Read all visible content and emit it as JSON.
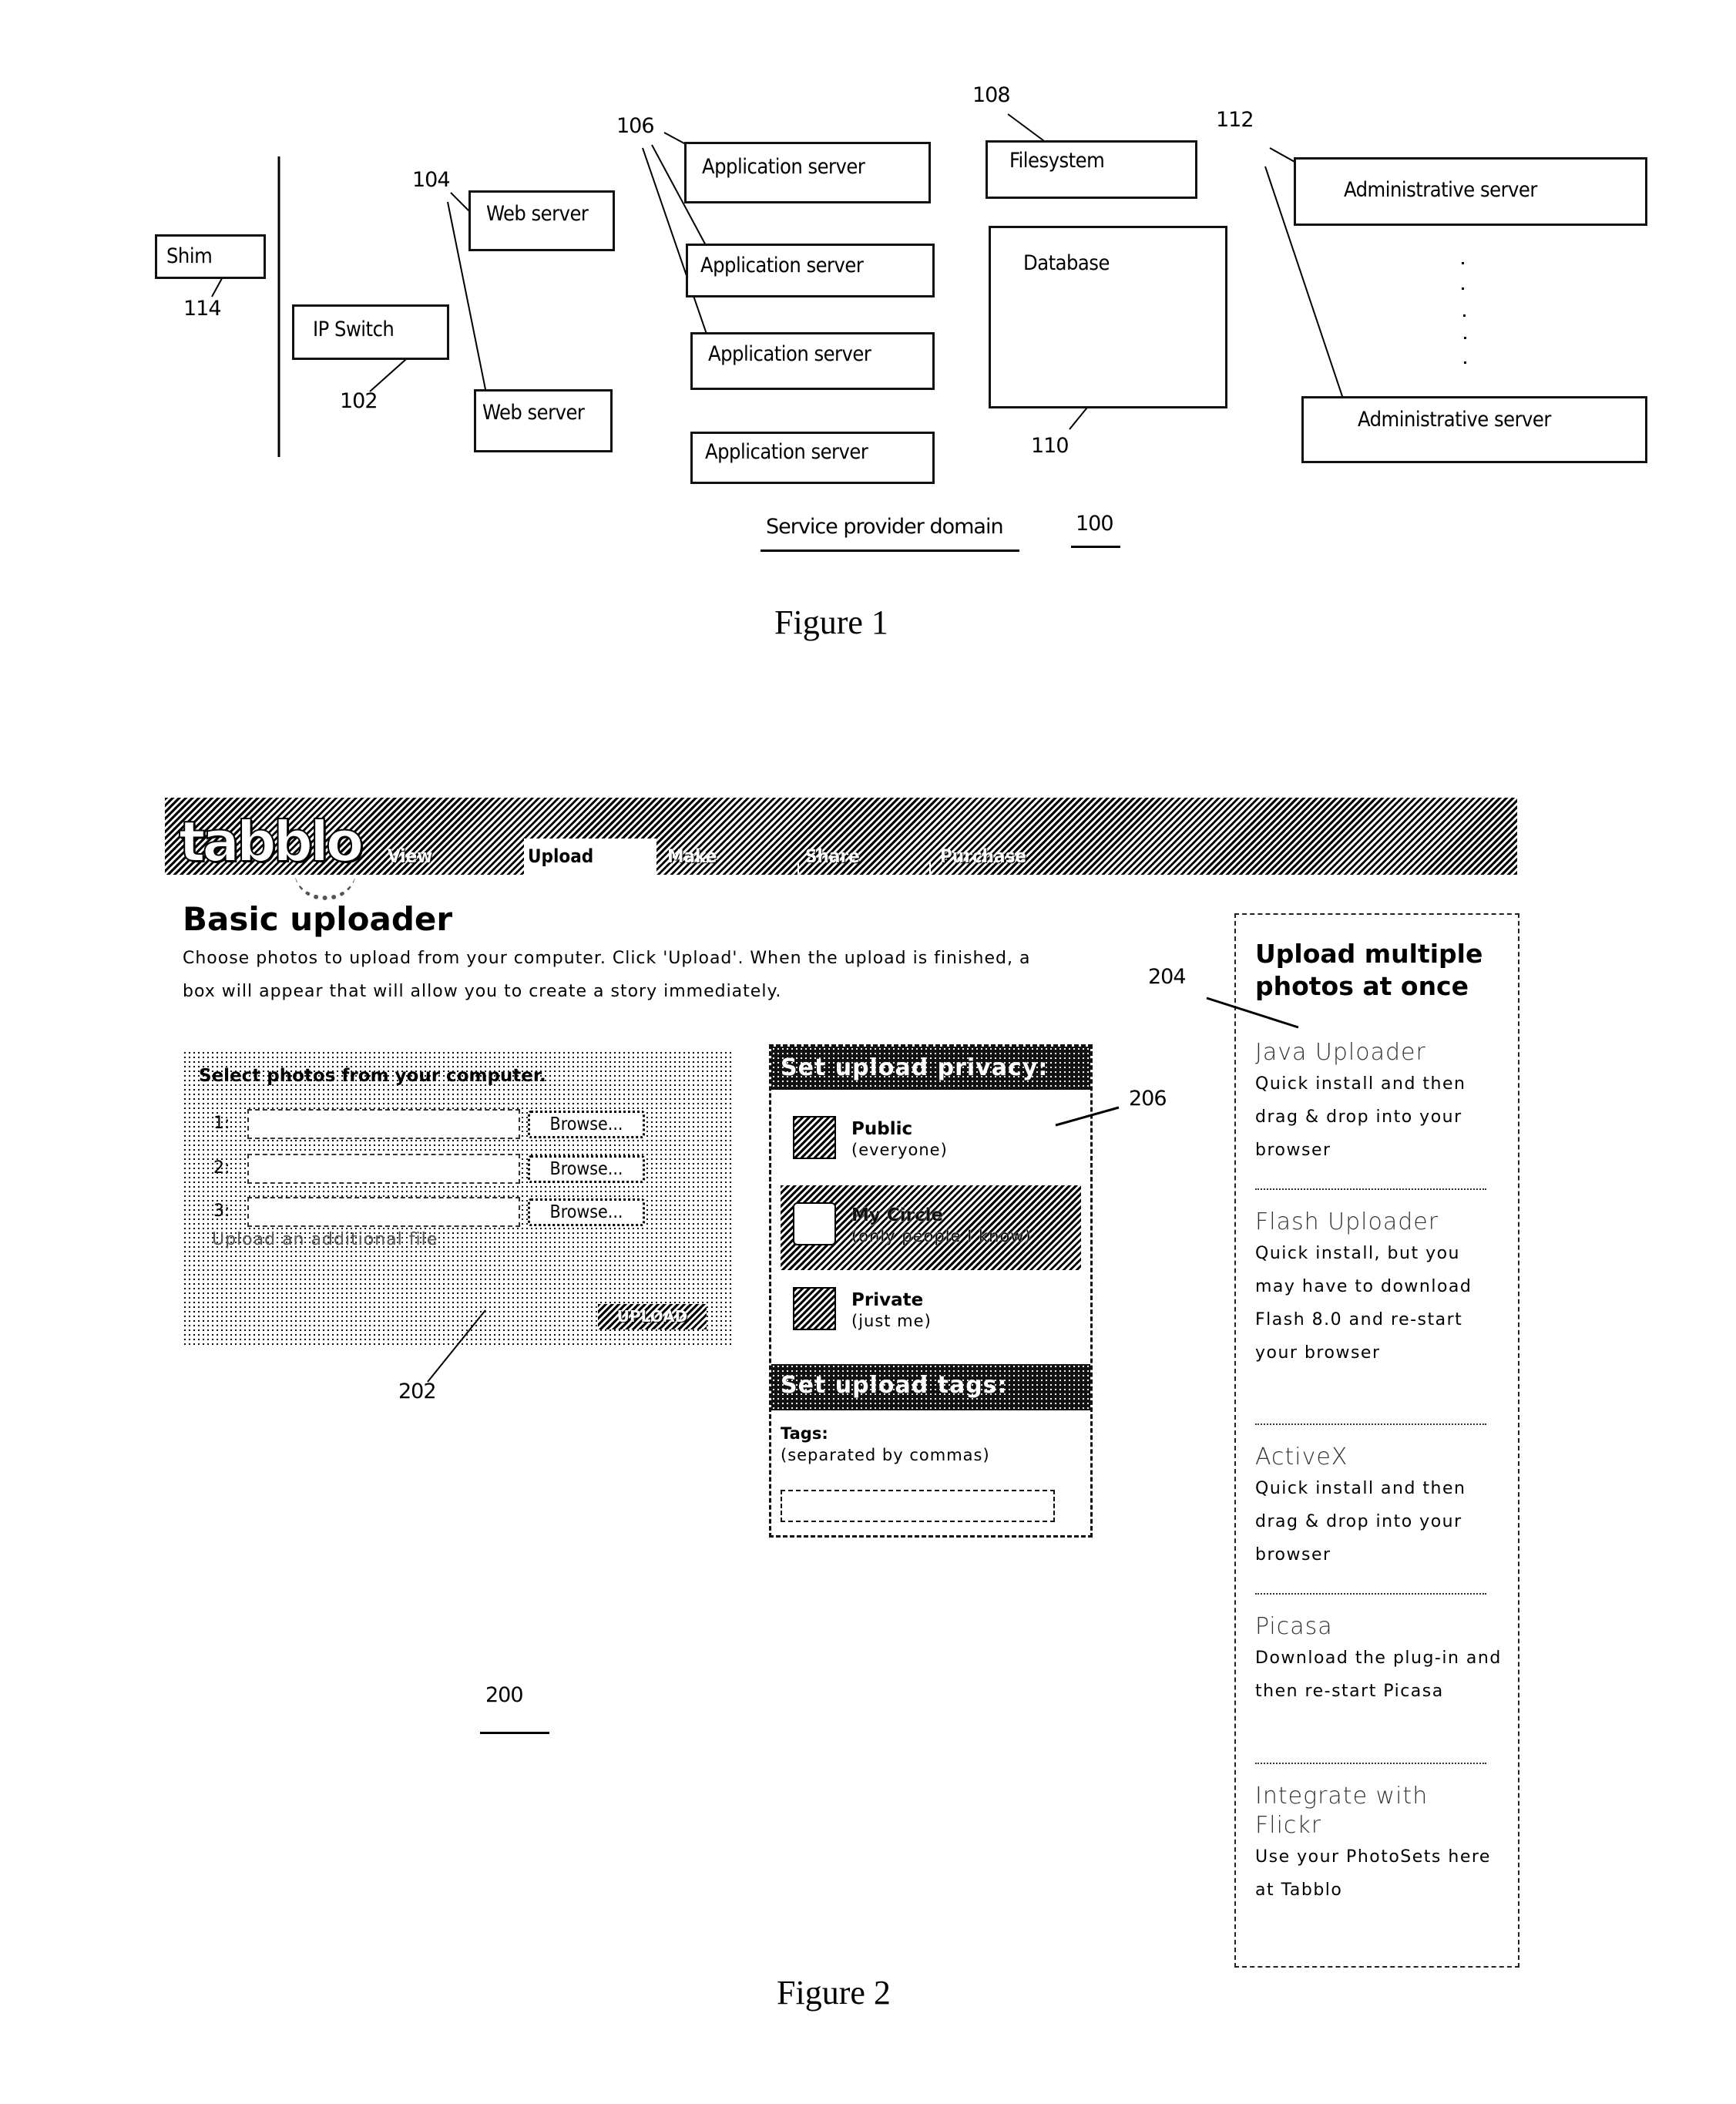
{
  "figure1": {
    "caption": "Figure 1",
    "domain_label": "Service provider domain",
    "domain_ref": "100",
    "components": {
      "shim": "Shim",
      "ip_switch": "IP Switch",
      "web_servers": [
        "Web server",
        "Web server"
      ],
      "application_servers": [
        "Application server",
        "Application server",
        "Application server",
        "Application server"
      ],
      "filesystem": "Filesystem",
      "database": "Database",
      "administrative_servers": [
        "Administrative server",
        "Administrative server"
      ]
    },
    "refs": {
      "ip_switch": "102",
      "web_servers": "104",
      "application_servers": "106",
      "filesystem": "108",
      "database": "110",
      "administrative_servers": "112",
      "shim": "114"
    }
  },
  "figure2": {
    "caption": "Figure 2",
    "page_ref": "200",
    "refs": {
      "upload_panel": "202",
      "multi_upload_sidebar": "204",
      "privacy_panel": "206"
    },
    "app": {
      "logo": "tabblo",
      "tabs": [
        {
          "label": "View",
          "active": false
        },
        {
          "label": "Upload",
          "active": true
        },
        {
          "label": "Make",
          "active": false
        },
        {
          "label": "Share",
          "active": false
        },
        {
          "label": "Purchase",
          "active": false
        }
      ],
      "title": "Basic uploader",
      "intro": "Choose photos to upload from your computer. Click 'Upload'. When the upload is finished, a box will appear that will allow you to create a story immediately.",
      "upload_panel": {
        "title": "Select photos from your computer.",
        "rows": [
          {
            "num": "1:",
            "value": "",
            "browse": "Browse..."
          },
          {
            "num": "2:",
            "value": "",
            "browse": "Browse..."
          },
          {
            "num": "3:",
            "value": "",
            "browse": "Browse..."
          }
        ],
        "add_file_link": "Upload an additional file",
        "upload_button": "UPLOAD"
      },
      "privacy": {
        "heading": "Set upload privacy:",
        "options": [
          {
            "name": "Public",
            "sub": "(everyone)",
            "icon": "globe-icon",
            "selected": false
          },
          {
            "name": "My Circle",
            "sub": "(only people I know)",
            "icon": "circle-people-icon",
            "selected": true
          },
          {
            "name": "Private",
            "sub": "(just me)",
            "icon": "person-icon",
            "selected": false
          }
        ]
      },
      "tags": {
        "heading": "Set upload tags:",
        "label": "Tags:",
        "hint": "(separated by commas)",
        "value": ""
      },
      "sidebar": {
        "title": "Upload multiple photos at once",
        "items": [
          {
            "name": "Java Uploader",
            "desc": "Quick install and then drag & drop into your browser"
          },
          {
            "name": "Flash Uploader",
            "desc": "Quick install, but you may have to download Flash 8.0 and re-start your browser"
          },
          {
            "name": "ActiveX",
            "desc": "Quick install and then drag & drop into your browser"
          },
          {
            "name": "Picasa",
            "desc": "Download the plug-in and then re-start Picasa"
          },
          {
            "name": "Integrate with Flickr",
            "desc": "Use your PhotoSets here at Tabblo"
          }
        ]
      }
    }
  }
}
